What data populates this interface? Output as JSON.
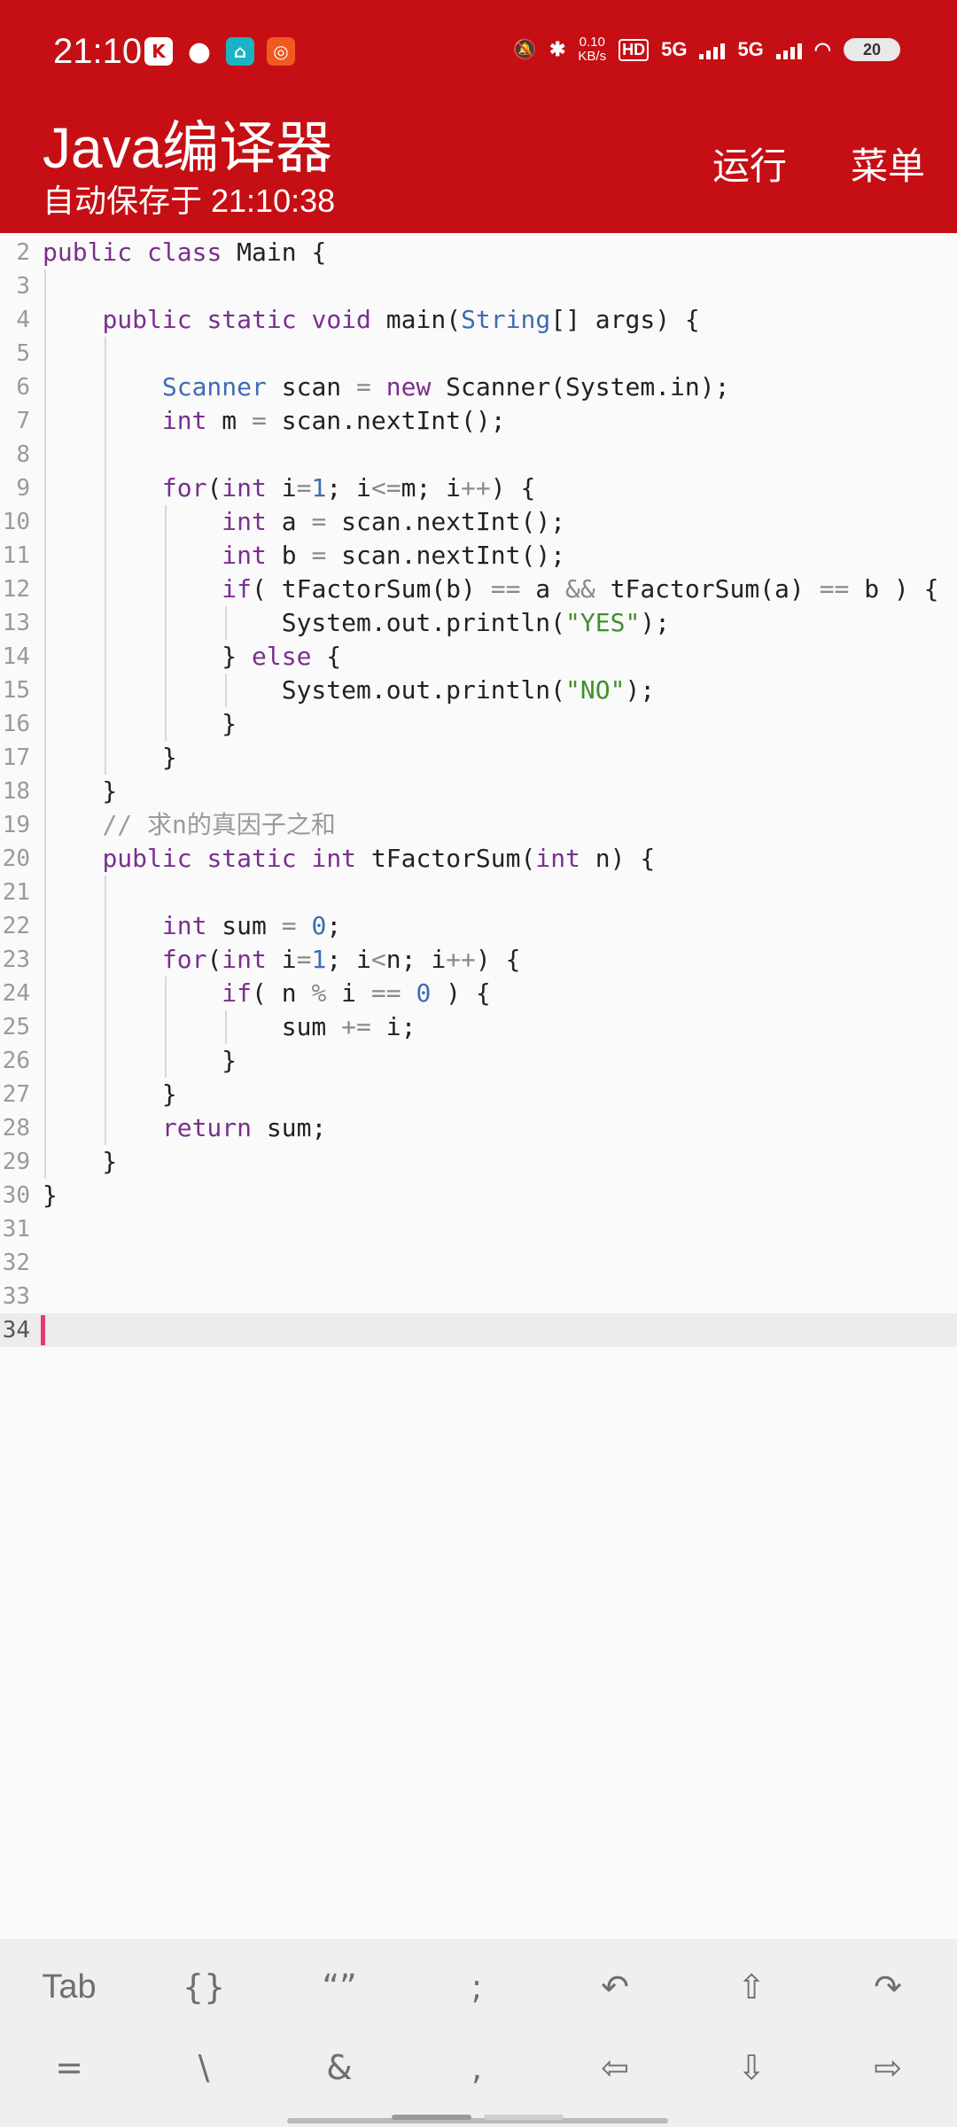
{
  "status_bar": {
    "time": "21:10",
    "net_speed_value": "0.10",
    "net_speed_unit": "KB/s",
    "hd_label": "HD",
    "sim1_label": "5G",
    "sim2_label": "5G",
    "battery": "20"
  },
  "header": {
    "title": "Java编译器",
    "subtitle": "自动保存于 21:10:38",
    "run_label": "运行",
    "menu_label": "菜单"
  },
  "editor": {
    "current_line": "34",
    "lines": [
      {
        "no": "2",
        "code": "public class Main {"
      },
      {
        "no": "3",
        "code": ""
      },
      {
        "no": "4",
        "code": "    public static void main(String[] args) {"
      },
      {
        "no": "5",
        "code": ""
      },
      {
        "no": "6",
        "code": "        Scanner scan = new Scanner(System.in);"
      },
      {
        "no": "7",
        "code": "        int m = scan.nextInt();"
      },
      {
        "no": "8",
        "code": ""
      },
      {
        "no": "9",
        "code": "        for(int i=1; i<=m; i++) {"
      },
      {
        "no": "10",
        "code": "            int a = scan.nextInt();"
      },
      {
        "no": "11",
        "code": "            int b = scan.nextInt();"
      },
      {
        "no": "12",
        "code": "            if( tFactorSum(b) == a && tFactorSum(a) == b ) {"
      },
      {
        "no": "13",
        "code": "                System.out.println(\"YES\");"
      },
      {
        "no": "14",
        "code": "            } else {"
      },
      {
        "no": "15",
        "code": "                System.out.println(\"NO\");"
      },
      {
        "no": "16",
        "code": "            }"
      },
      {
        "no": "17",
        "code": "        }"
      },
      {
        "no": "18",
        "code": "    }"
      },
      {
        "no": "19",
        "code": "    // 求n的真因子之和"
      },
      {
        "no": "20",
        "code": "    public static int tFactorSum(int n) {"
      },
      {
        "no": "21",
        "code": ""
      },
      {
        "no": "22",
        "code": "        int sum = 0;"
      },
      {
        "no": "23",
        "code": "        for(int i=1; i<n; i++) {"
      },
      {
        "no": "24",
        "code": "            if( n % i == 0 ) {"
      },
      {
        "no": "25",
        "code": "                sum += i;"
      },
      {
        "no": "26",
        "code": "            }"
      },
      {
        "no": "27",
        "code": "        }"
      },
      {
        "no": "28",
        "code": "        return sum;"
      },
      {
        "no": "29",
        "code": "    }"
      },
      {
        "no": "30",
        "code": "}"
      },
      {
        "no": "31",
        "code": ""
      },
      {
        "no": "32",
        "code": ""
      },
      {
        "no": "33",
        "code": ""
      },
      {
        "no": "34",
        "code": ""
      }
    ]
  },
  "keyboard_bar": {
    "row1": [
      {
        "label": "Tab",
        "name": "tab-key"
      },
      {
        "label": "{}",
        "name": "braces-key"
      },
      {
        "label": "“”",
        "name": "quotes-key"
      },
      {
        "label": ";",
        "name": "semicolon-key"
      },
      {
        "label": "↶",
        "name": "undo-icon"
      },
      {
        "label": "⇧",
        "name": "arrow-up-icon"
      },
      {
        "label": "↷",
        "name": "redo-icon"
      }
    ],
    "row2": [
      {
        "label": "=",
        "name": "equals-key"
      },
      {
        "label": "\\",
        "name": "backslash-key"
      },
      {
        "label": "&",
        "name": "ampersand-key"
      },
      {
        "label": ",",
        "name": "comma-key"
      },
      {
        "label": "⇦",
        "name": "arrow-left-icon"
      },
      {
        "label": "⇩",
        "name": "arrow-down-icon"
      },
      {
        "label": "⇨",
        "name": "arrow-right-icon"
      }
    ]
  },
  "colors": {
    "header_bg": "#c50f14",
    "keyword": "#7a2f8e",
    "type": "#3e6bb5",
    "string": "#3f8f2b",
    "comment": "#9a9a9a",
    "cursor": "#e63a6f"
  }
}
